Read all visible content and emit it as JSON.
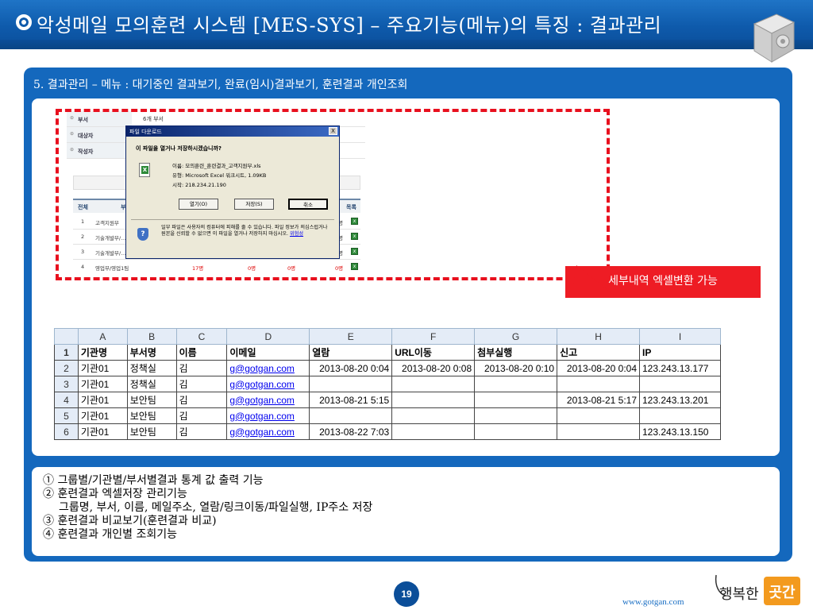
{
  "header": {
    "title": "악성메일 모의훈련 시스템 [MES-SYS] – 주요기능(메뉴)의 특징 : 결과관리"
  },
  "section": {
    "heading": "5. 결과관리 – 메뉴 : 대기중인 결과보기, 완료(임시)결과보기, 훈련결과 개인조회"
  },
  "app_screenshot": {
    "info_rows": [
      {
        "label": "부서",
        "value": "6개 부서"
      },
      {
        "label": "대상자",
        "value": ""
      },
      {
        "label": "작성자",
        "value": ""
      }
    ],
    "table_header": {
      "no": "전체",
      "dept": "부...",
      "list": "목록"
    },
    "rows": [
      {
        "no": "1",
        "dept": "고객지원부",
        "tail": "명"
      },
      {
        "no": "2",
        "dept": "기술개발부/...",
        "tail": "명"
      },
      {
        "no": "3",
        "dept": "기술개발부/...",
        "tail": "명"
      },
      {
        "no": "4",
        "dept": "영업부/영업1팀",
        "c1": "17명",
        "c2": "0명",
        "c3": "0명",
        "c4": "0명"
      }
    ],
    "dialog": {
      "title": "파일 다운로드",
      "close": "X",
      "question": "이 파일을 열거나 저장하시겠습니까?",
      "name": "이름:  모의훈련_훈련결과_고객지원부.xls",
      "type": "유형:  Microsoft Excel 워크시트, 1.09KB",
      "source": "시작:  218.234.21.190",
      "open_label": "열기(O)",
      "save_label": "저장(S)",
      "cancel_label": "취소",
      "warning": "일부 파일은 사용자의 컴퓨터에 피해를 줄 수 있습니다. 파일 정보가 의심스럽거나 원본을 신뢰할 수 없으면 이 파일을 열거나 저장하지 마십시오.",
      "warning_link": "위험성"
    }
  },
  "callout": {
    "text": "세부내역 엑셀변환 가능"
  },
  "excel": {
    "columns": [
      "A",
      "B",
      "C",
      "D",
      "E",
      "F",
      "G",
      "H",
      "I"
    ],
    "row_numbers": [
      "1",
      "2",
      "3",
      "4",
      "5",
      "6"
    ],
    "header": [
      "기관명",
      "부서명",
      "이름",
      "이메일",
      "열람",
      "URL이동",
      "첨부실행",
      "신고",
      "IP"
    ],
    "rows": [
      [
        "기관01",
        "정책실",
        "김",
        "g@gotgan.com",
        "2013-08-20 0:04",
        "2013-08-20 0:08",
        "2013-08-20 0:10",
        "2013-08-20 0:04",
        "123.243.13.177"
      ],
      [
        "기관01",
        "정책실",
        "김",
        "g@gotgan.com",
        "",
        "",
        "",
        "",
        ""
      ],
      [
        "기관01",
        "보안팀",
        "김",
        "g@gotgan.com",
        "2013-08-21 5:15",
        "",
        "",
        "2013-08-21 5:17",
        "123.243.13.201"
      ],
      [
        "기관01",
        "보안팀",
        "김",
        "g@gotgan.com",
        "",
        "",
        "",
        "",
        ""
      ],
      [
        "기관01",
        "보안팀",
        "김",
        "g@gotgan.com",
        "2013-08-22 7:03",
        "",
        "",
        "",
        "123.243.13.150"
      ]
    ]
  },
  "notes": {
    "items": [
      "① 그룹별/기관별/부서별결과 통계 값 출력 기능",
      "② 훈련결과 엑셀저장 관리기능",
      "그룹명, 부서, 이름, 메일주소, 열람/링크이동/파일실행, IP주소 저장",
      "③ 훈련결과 비교보기(훈련결과 비교)",
      "④ 훈련결과 개인별 조회기능"
    ]
  },
  "footer": {
    "page_number": "19",
    "url": "www.gotgan.com",
    "brand_text": "행복한 곳간"
  },
  "colors": {
    "primary_blue": "#1468bd",
    "title_blue": "#0e5aab",
    "highlight_red": "#e8101e",
    "callout_red": "#ee1c24",
    "link_blue": "#0000ee",
    "brand_orange": "#f39a1e"
  }
}
